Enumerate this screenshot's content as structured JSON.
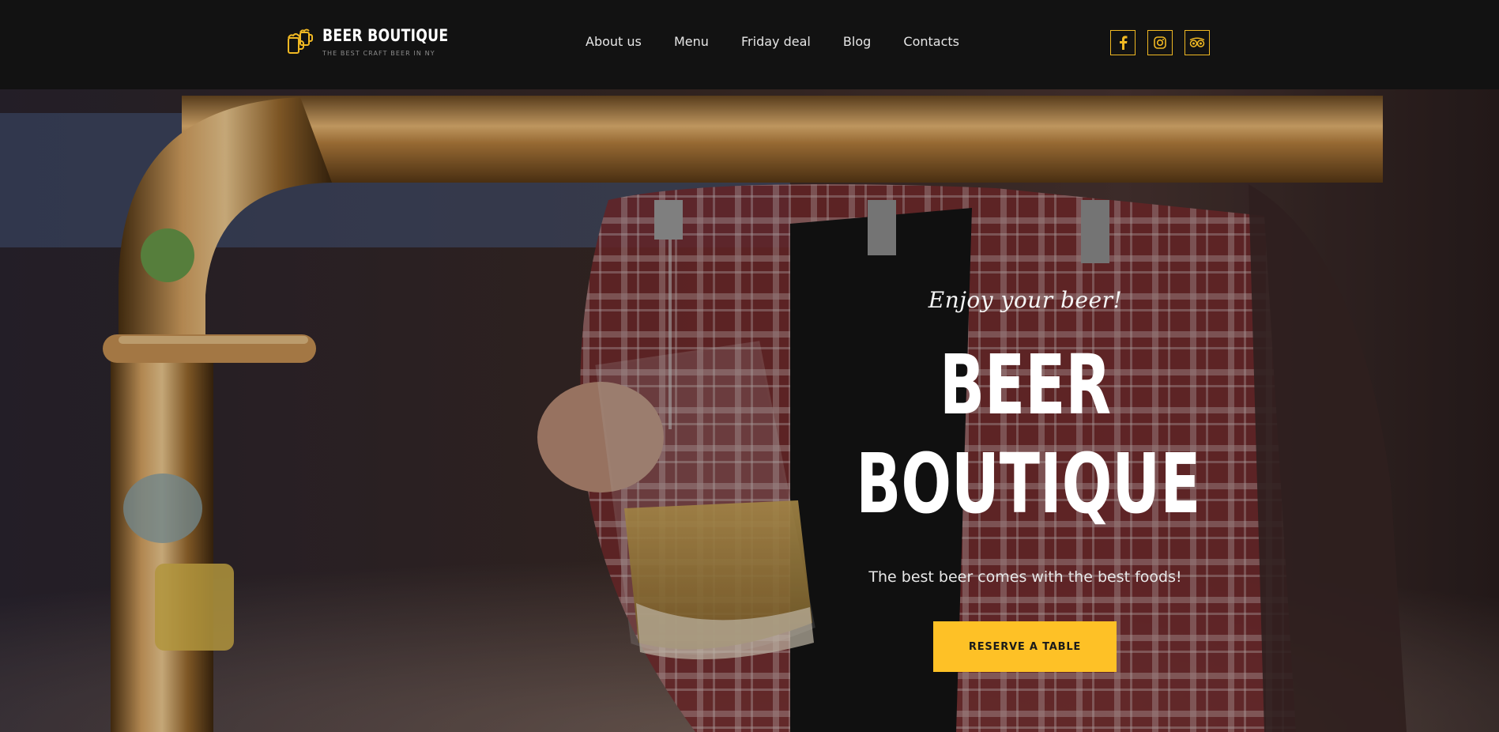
{
  "brand": {
    "name": "BEER BOUTIQUE",
    "slogan": "THE BEST CRAFT BEER IN NY",
    "logo_icon": "beer-mugs-icon",
    "accent_color": "#fec126"
  },
  "nav": {
    "items": [
      {
        "label": "About us"
      },
      {
        "label": "Menu"
      },
      {
        "label": "Friday deal"
      },
      {
        "label": "Blog"
      },
      {
        "label": "Contacts"
      }
    ]
  },
  "socials": [
    {
      "icon": "facebook-icon"
    },
    {
      "icon": "instagram-icon"
    },
    {
      "icon": "tripadvisor-icon"
    }
  ],
  "hero": {
    "tagline": "Enjoy your beer!",
    "title_line1": "BEER",
    "title_line2": "BOUTIQUE",
    "subtitle": "The best beer comes with the best foods!",
    "cta_label": "RESERVE A TABLE",
    "background": "bartender pouring beer from brass tap"
  }
}
